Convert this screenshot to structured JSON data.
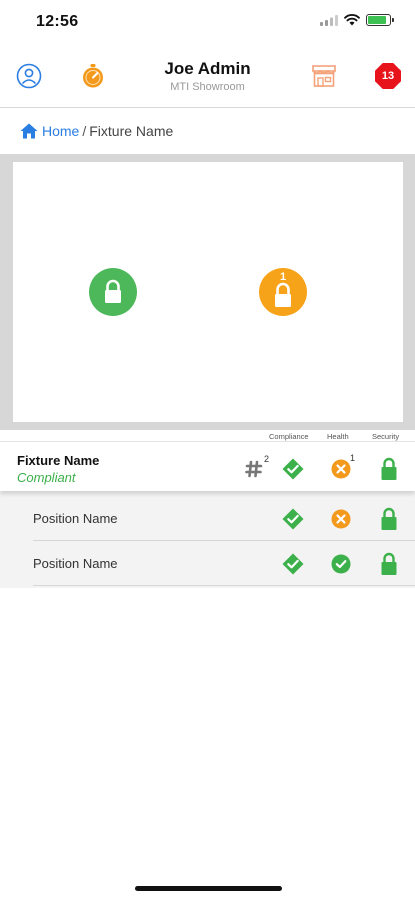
{
  "status_bar": {
    "time": "12:56",
    "battery_level": 0.85
  },
  "header": {
    "user_name": "Joe Admin",
    "location": "MTI Showroom",
    "alert_count": "13",
    "left_icons": [
      "user-icon",
      "timer-icon"
    ],
    "right_icons": [
      "store-icon",
      "alert-badge"
    ]
  },
  "breadcrumb": {
    "home": "Home",
    "separator": "/",
    "current": "Fixture Name"
  },
  "map": {
    "markers": [
      {
        "state": "locked",
        "color": "#4db85a"
      },
      {
        "state": "locked",
        "color": "#f6a31a",
        "count": "1"
      }
    ]
  },
  "columns": {
    "compliance": "Compliance",
    "health": "Health",
    "security": "Security"
  },
  "fixture": {
    "name": "Fixture Name",
    "status": "Compliant",
    "position_count": "2",
    "health_issue_count": "1",
    "compliance": "ok",
    "health": "error",
    "security": "locked"
  },
  "positions": [
    {
      "name": "Position Name",
      "compliance": "ok",
      "health": "error",
      "security": "locked"
    },
    {
      "name": "Position Name",
      "compliance": "ok",
      "health": "ok",
      "security": "locked"
    }
  ],
  "colors": {
    "ok": "#3cb04a",
    "warning": "#f39a1d",
    "error": "#e8141c",
    "link": "#2a7de1"
  }
}
